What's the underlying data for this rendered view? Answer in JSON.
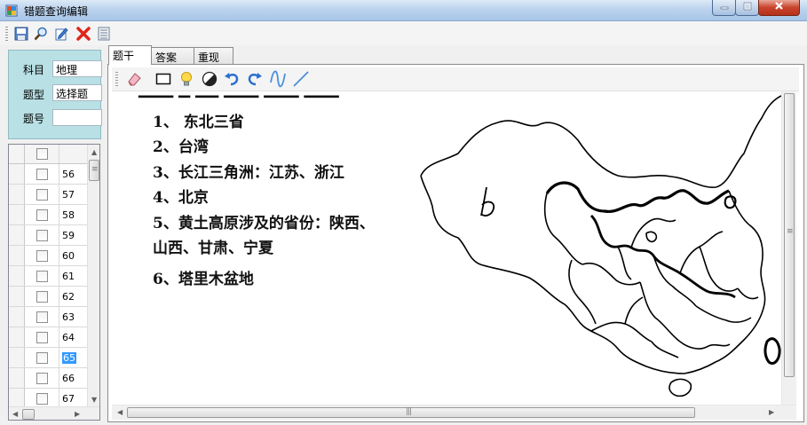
{
  "window": {
    "title": "错题查询编辑"
  },
  "toolbar": {
    "buttons": [
      {
        "name": "save-icon"
      },
      {
        "name": "search-icon"
      },
      {
        "name": "edit-icon"
      },
      {
        "name": "delete-icon"
      },
      {
        "name": "list-icon"
      }
    ]
  },
  "info": {
    "subject_label": "科目",
    "subject_value": "地理",
    "type_label": "题型",
    "type_value": "选择题",
    "number_label": "题号",
    "number_value": ""
  },
  "list": {
    "rows": [
      "56",
      "57",
      "58",
      "59",
      "60",
      "61",
      "62",
      "63",
      "64",
      "65",
      "66",
      "67"
    ],
    "selected": "65"
  },
  "tabs": [
    {
      "label": "题干",
      "active": true
    },
    {
      "label": "答案",
      "active": false
    },
    {
      "label": "重现",
      "active": false
    }
  ],
  "draw_tools": [
    {
      "name": "eraser-icon"
    },
    {
      "name": "rectangle-icon"
    },
    {
      "name": "lightbulb-icon"
    },
    {
      "name": "contrast-icon"
    },
    {
      "name": "undo-icon"
    },
    {
      "name": "redo-icon"
    },
    {
      "name": "curve-icon"
    },
    {
      "name": "line-icon"
    }
  ],
  "content": {
    "answers": [
      "1、 东北三省",
      "2、台湾",
      "3、长江三角洲：江苏、浙江",
      "4、北京",
      "5、黄土高原涉及的省份：陕西、",
      "山西、甘肃、宁夏",
      "6、塔里木盆地"
    ],
    "handwriting": "b"
  }
}
